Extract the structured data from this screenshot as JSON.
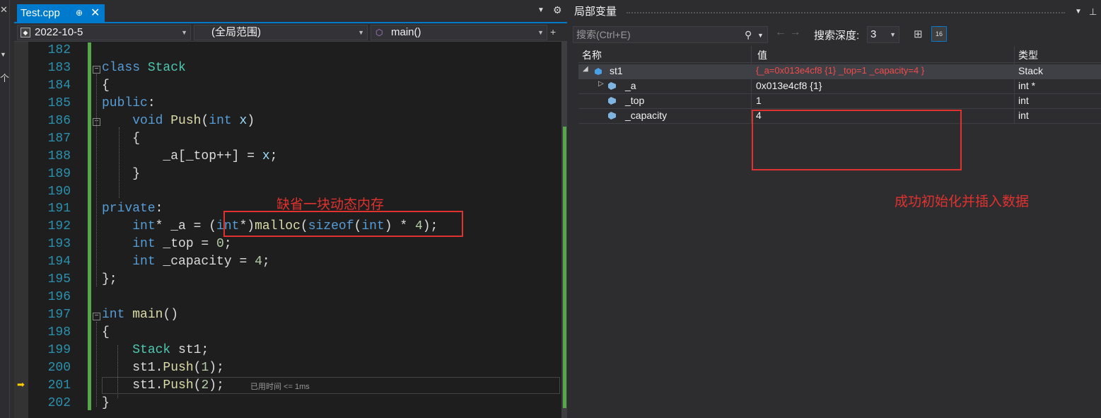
{
  "editor": {
    "tab_title": "Test.cpp",
    "tab_pin": "⊕",
    "tab_close": "✕",
    "nav_project": "2022-10-5",
    "nav_scope": "(全局范围)",
    "nav_function": "main()",
    "line_numbers": [
      "182",
      "183",
      "184",
      "185",
      "186",
      "187",
      "188",
      "189",
      "190",
      "191",
      "192",
      "193",
      "194",
      "195",
      "196",
      "197",
      "198",
      "199",
      "200",
      "201",
      "202"
    ],
    "elapsed_hint": "已用时间 <= 1ms",
    "annotation": "缺省一块动态内存"
  },
  "locals": {
    "title": "局部变量",
    "search_placeholder": "搜索(Ctrl+E)",
    "depth_label": "搜索深度:",
    "depth_value": "3",
    "hex_label": "16",
    "columns": {
      "name": "名称",
      "value": "值",
      "type": "类型"
    },
    "rows": [
      {
        "name": "st1",
        "value": "{_a=0x013e4cf8 {1} _top=1 _capacity=4 }",
        "type": "Stack"
      },
      {
        "name": "_a",
        "value": "0x013e4cf8 {1}",
        "type": "int *"
      },
      {
        "name": "_top",
        "value": "1",
        "type": "int"
      },
      {
        "name": "_capacity",
        "value": "4",
        "type": "int"
      }
    ],
    "annotation": "成功初始化并插入数据"
  },
  "colors": {
    "accent": "#007acc",
    "annotation_red": "#e0322f",
    "keyword": "#569cd6",
    "type": "#4ec9b0",
    "function": "#dcdcaa",
    "line_number": "#2b91af"
  }
}
